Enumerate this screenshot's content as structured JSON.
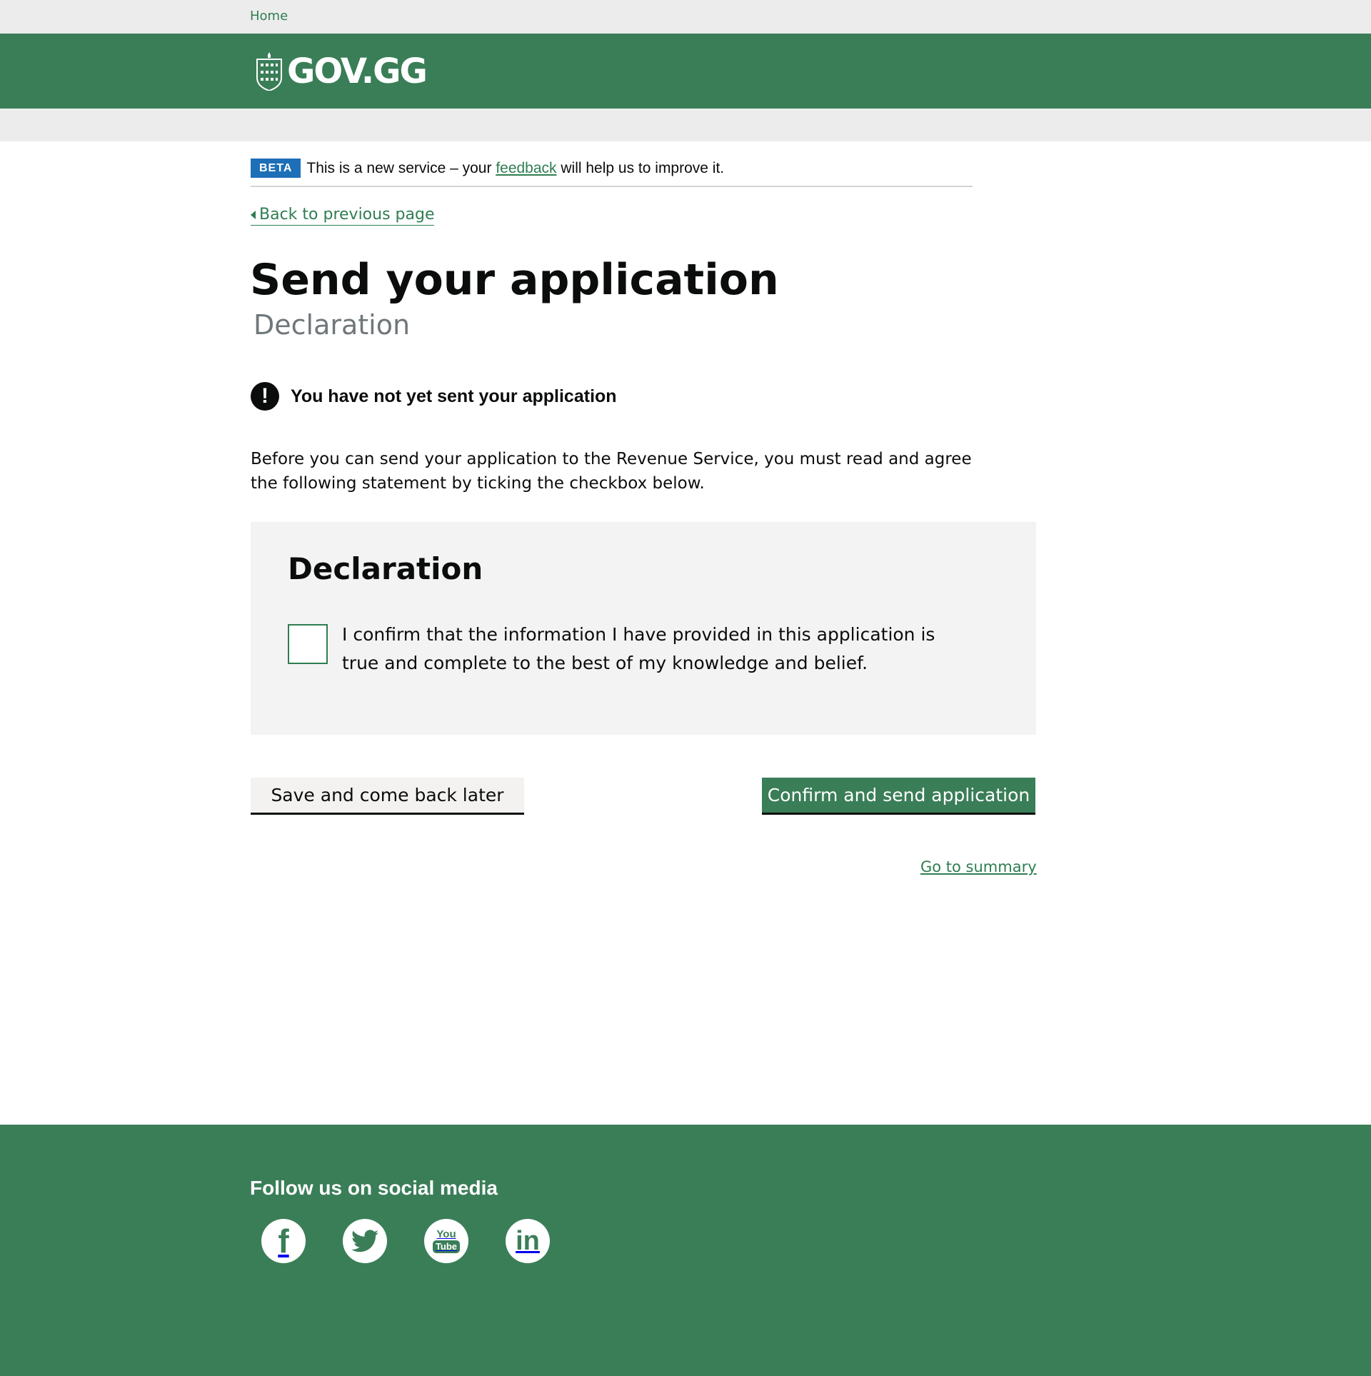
{
  "topbar": {
    "home_link": "Home"
  },
  "header": {
    "logo_text": "GOV.GG",
    "crest_icon": "guernsey-crest-icon"
  },
  "beta_banner": {
    "tag": "BETA",
    "text_before": "This is a new service – your ",
    "link": "feedback",
    "text_after": " will help us to improve it."
  },
  "nav": {
    "back_link": "Back to previous page"
  },
  "page": {
    "title": "Send your application",
    "subtitle": "Declaration",
    "warning": "You have not yet sent your application",
    "warning_icon": "!",
    "intro": "Before you can send your application to the Revenue Service, you must read and agree the following statement by ticking the checkbox below."
  },
  "declaration": {
    "heading": "Declaration",
    "checkbox_label": "I confirm that the information I have provided in this application is true and complete to the best of my knowledge and belief.",
    "checked": false
  },
  "actions": {
    "save_label": "Save and come back later",
    "confirm_label": "Confirm and send application",
    "summary_link": "Go to summary"
  },
  "footer": {
    "heading": "Follow us on social media",
    "social": [
      {
        "name": "facebook-icon",
        "glyph": "f"
      },
      {
        "name": "twitter-icon",
        "glyph": ""
      },
      {
        "name": "youtube-icon",
        "glyph_top": "You",
        "glyph_bottom": "Tube"
      },
      {
        "name": "linkedin-icon",
        "glyph": "in"
      }
    ]
  },
  "colors": {
    "brand_green": "#3a7e58",
    "link_green": "#2f7d52",
    "beta_blue": "#1d6fb8"
  }
}
